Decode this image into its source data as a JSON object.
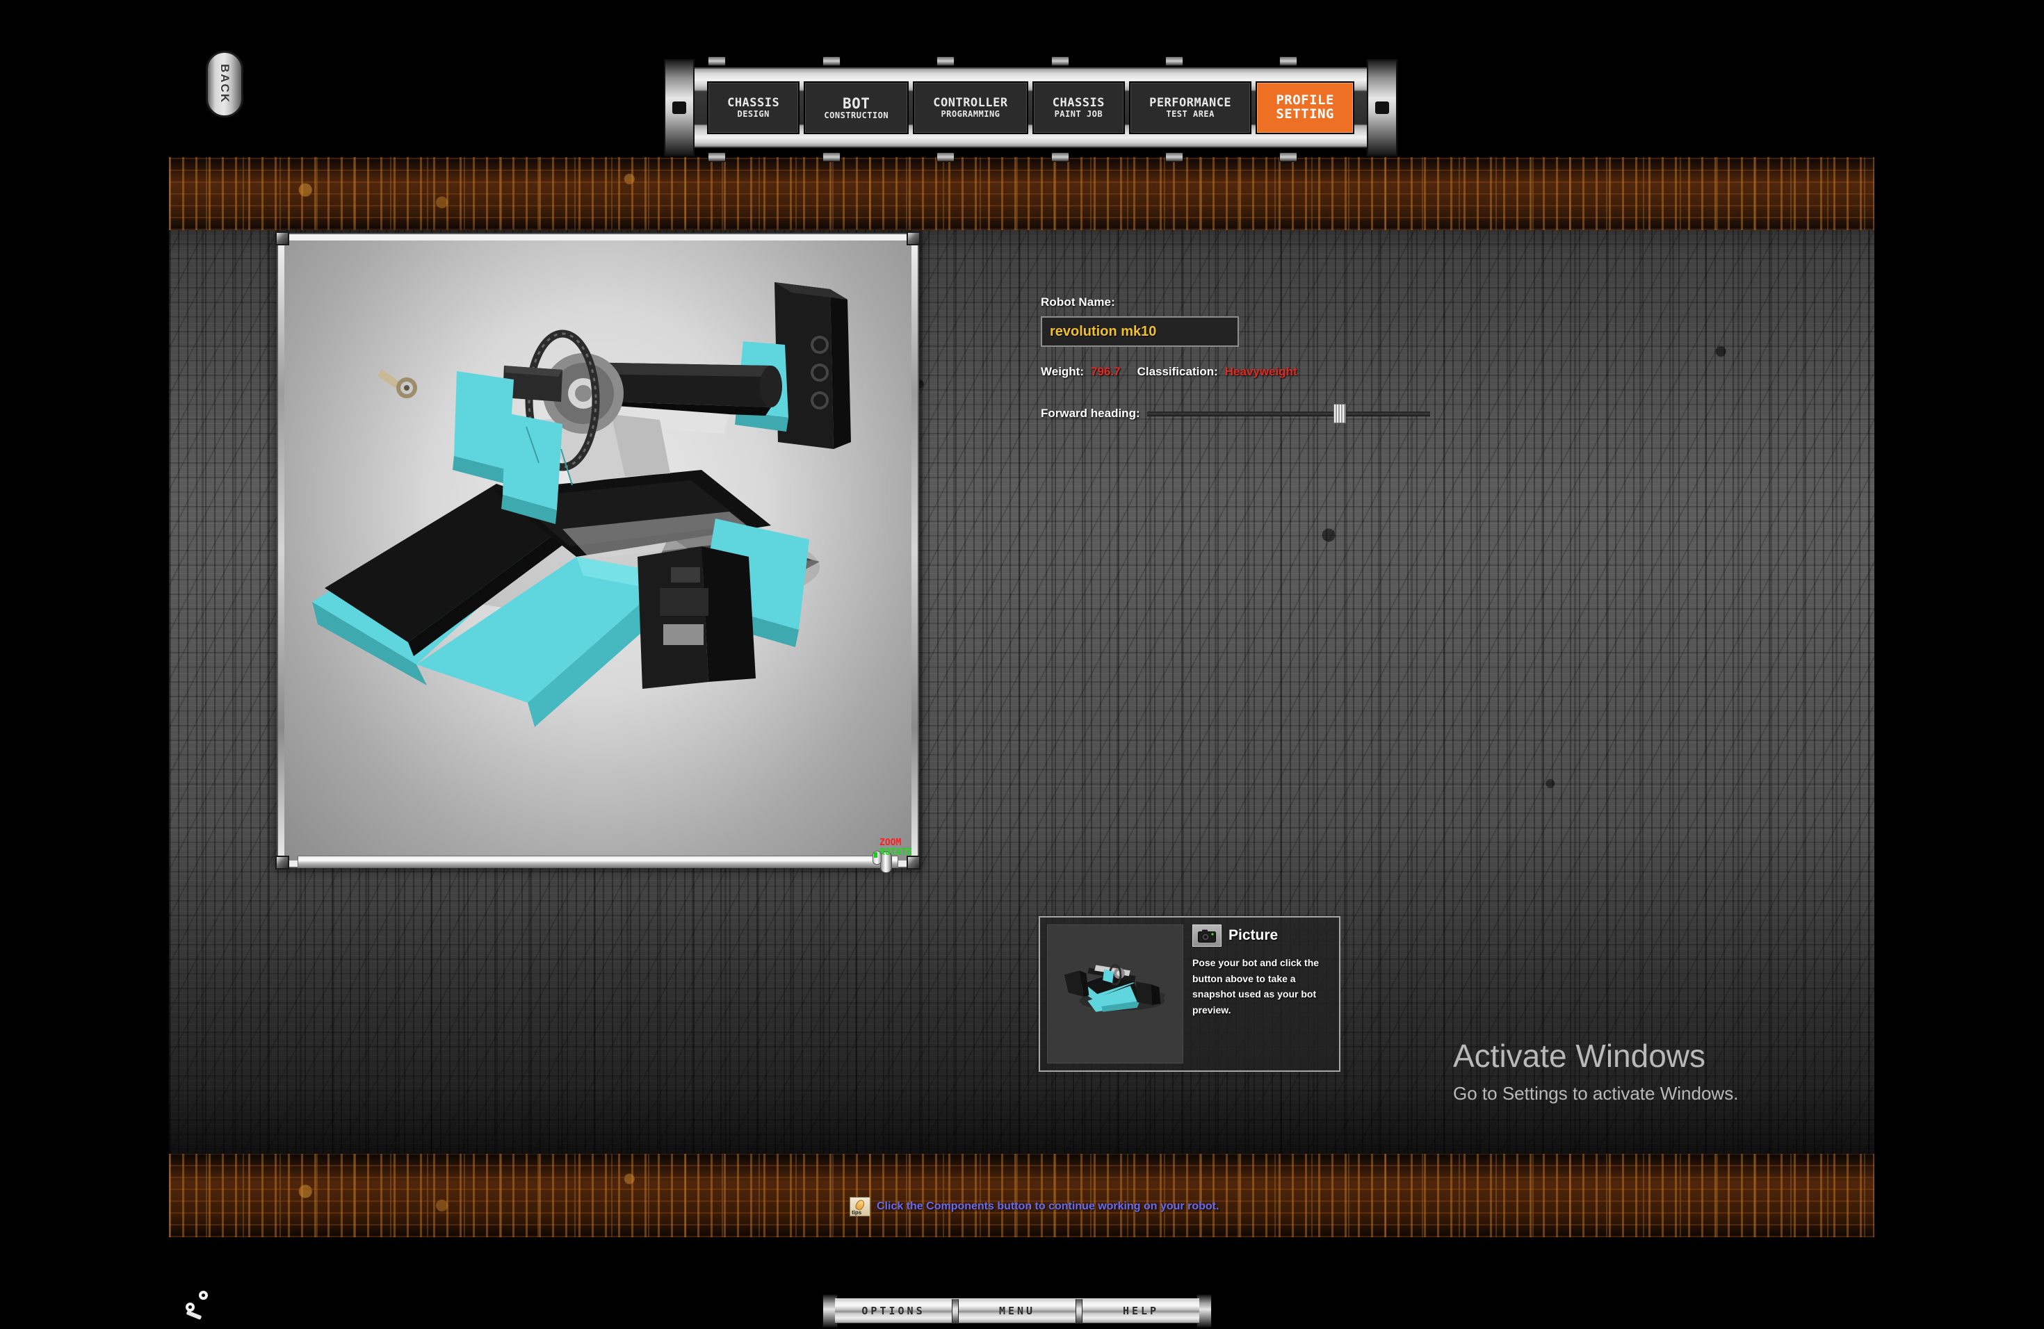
{
  "app": {
    "back_label": "BACK"
  },
  "nav": {
    "tabs": [
      {
        "line1": "CHASSIS",
        "line2": "DESIGN",
        "active": false
      },
      {
        "line1": "BOT",
        "line2": "CONSTRUCTION",
        "active": false
      },
      {
        "line1": "CONTROLLER",
        "line2": "PROGRAMMING",
        "active": false
      },
      {
        "line1": "CHASSIS",
        "line2": "PAINT JOB",
        "active": false
      },
      {
        "line1": "PERFORMANCE",
        "line2": "TEST AREA",
        "active": false
      },
      {
        "line1": "PROFILE",
        "line2": "SETTING",
        "active": true
      }
    ]
  },
  "viewport": {
    "zoom_label": "ZOOM",
    "rotate_label": "ROTATE",
    "zoom_color": "#ff1f1f",
    "rotate_color": "#15dd15",
    "robot_primary_color": "#5fd6dd",
    "robot_secondary_color": "#141414"
  },
  "profile": {
    "name_label": "Robot Name:",
    "name_value": "revolution mk10",
    "name_color": "#f1c02e",
    "weight_label": "Weight:",
    "weight_value": "796.7",
    "classification_label": "Classification:",
    "classification_value": "Heavyweight",
    "stat_value_color": "#e02a20",
    "heading_label": "Forward heading:"
  },
  "picture": {
    "title": "Picture",
    "description": "Pose your bot and click the button above to take a snapshot used as your bot preview."
  },
  "tip": {
    "text": "Click the Components button to continue working on your robot.",
    "color": "#6a6af0"
  },
  "watermark": {
    "title": "Activate Windows",
    "subtitle": "Go to Settings to activate Windows."
  },
  "bottom_bar": {
    "items": [
      "OPTIONS",
      "MENU",
      "HELP"
    ]
  }
}
